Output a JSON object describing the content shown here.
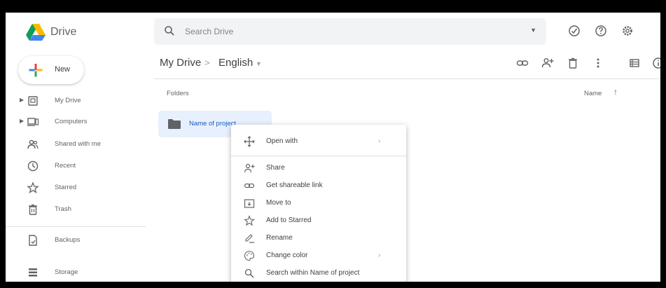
{
  "app": {
    "name": "Drive"
  },
  "search": {
    "placeholder": "Search Drive"
  },
  "header_icons": [
    "offline-status-icon",
    "help-icon",
    "settings-icon"
  ],
  "new_button": {
    "label": "New"
  },
  "sidebar": {
    "items": [
      {
        "label": "My Drive",
        "icon": "my-drive-icon",
        "expandable": true
      },
      {
        "label": "Computers",
        "icon": "computers-icon",
        "expandable": true
      },
      {
        "label": "Shared with me",
        "icon": "shared-icon",
        "expandable": false
      },
      {
        "label": "Recent",
        "icon": "recent-icon",
        "expandable": false
      },
      {
        "label": "Starred",
        "icon": "star-icon",
        "expandable": false
      },
      {
        "label": "Trash",
        "icon": "trash-icon",
        "expandable": false
      },
      {
        "label": "Backups",
        "icon": "backups-icon",
        "expandable": false
      },
      {
        "label": "Storage",
        "icon": "storage-icon",
        "expandable": false
      }
    ]
  },
  "breadcrumb": {
    "root": "My Drive",
    "separator": ">",
    "current": "English"
  },
  "toolbar_icons": [
    "link-icon",
    "add-person-icon",
    "trash-icon",
    "more-vert-icon",
    "list-view-icon",
    "info-icon"
  ],
  "main": {
    "section_label": "Folders",
    "sort": {
      "label": "Name",
      "direction": "ascending"
    },
    "folders": [
      {
        "name": "Name of project"
      }
    ]
  },
  "context_menu": {
    "items": [
      {
        "label": "Open with",
        "icon": "open-with-icon",
        "submenu": true
      },
      {
        "label": "Share",
        "icon": "share-icon",
        "submenu": false
      },
      {
        "label": "Get shareable link",
        "icon": "link-icon",
        "submenu": false
      },
      {
        "label": "Move to",
        "icon": "move-to-icon",
        "submenu": false
      },
      {
        "label": "Add to Starred",
        "icon": "star-icon",
        "submenu": false
      },
      {
        "label": "Rename",
        "icon": "rename-icon",
        "submenu": false
      },
      {
        "label": "Change color",
        "icon": "palette-icon",
        "submenu": true
      },
      {
        "label": "Search within Name of project",
        "icon": "search-icon",
        "submenu": false
      }
    ]
  },
  "colors": {
    "accent_blue": "#1a73e8",
    "selected_bg": "#e8f0fe",
    "folder_icon": "#5f6368",
    "text_dark": "#3c4043",
    "text_muted": "#5f6368"
  }
}
